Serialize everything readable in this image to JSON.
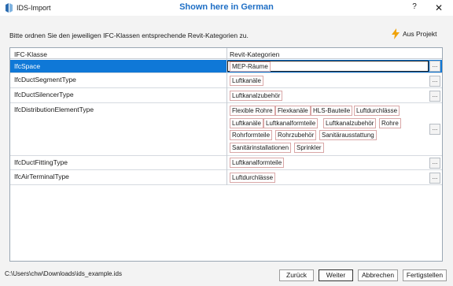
{
  "window": {
    "title": "IDS-Import",
    "overlay_note": "Shown here in German",
    "help_label": "?",
    "close_label": "✕",
    "accent_color": "#0f78d7",
    "overlay_color": "#1f6fc5"
  },
  "instruction": "Bitte ordnen Sie den jeweiligen IFC-Klassen entsprechende Revit-Kategorien zu.",
  "from_project": {
    "label": "Aus Projekt",
    "icon": "lightning-bolt-icon"
  },
  "grid": {
    "headers": {
      "ifc_class": "IFC-Klasse",
      "revit_categories": "Revit-Kategorien"
    },
    "rows": [
      {
        "ifc_class": "IfcSpace",
        "selected": true,
        "categories": [
          "MEP-Räume"
        ]
      },
      {
        "ifc_class": "IfcDuctSegmentType",
        "selected": false,
        "categories": [
          "Luftkanäle"
        ]
      },
      {
        "ifc_class": "IfcDuctSilencerType",
        "selected": false,
        "categories": [
          "Luftkanalzubehör"
        ]
      },
      {
        "ifc_class": "IfcDistributionElementType",
        "selected": false,
        "categories": [
          "Flexible Rohre",
          "Flexkanäle",
          "HLS-Bauteile",
          "Luftdurchlässe",
          "Luftkanäle",
          "Luftkanalformteile",
          "Luftkanalzubehör",
          "Rohre",
          "Rohrformteile",
          "Rohrzubehör",
          "Sanitärausstattung",
          "Sanitärinstallationen",
          "Sprinkler"
        ]
      },
      {
        "ifc_class": "IfcDuctFittingType",
        "selected": false,
        "categories": [
          "Luftkanalformteile"
        ]
      },
      {
        "ifc_class": "IfcAirTerminalType",
        "selected": false,
        "categories": [
          "Luftdurchlässe"
        ]
      }
    ],
    "browse_label": "..."
  },
  "footer": {
    "file_path": "C:\\Users\\chw\\Downloads\\ids_example.ids",
    "back_label": "Zurück",
    "next_label": "Weiter",
    "cancel_label": "Abbrechen",
    "finish_label": "Fertigstellen"
  }
}
